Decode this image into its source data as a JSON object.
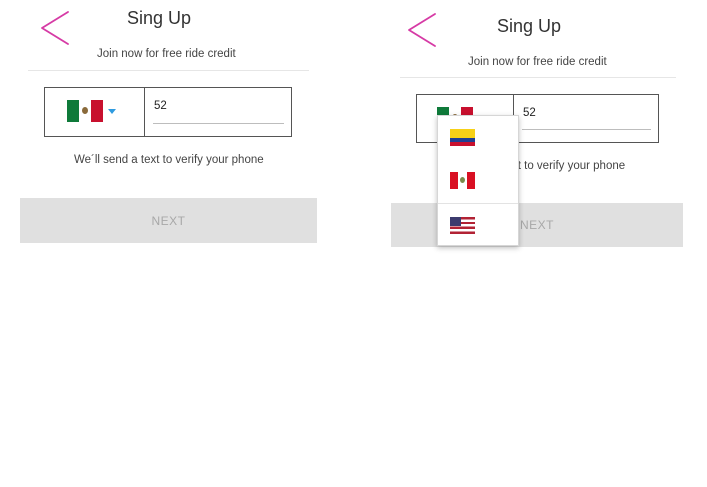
{
  "colors": {
    "back_icon": "#d63aa5",
    "accent_caret": "#2f9be0",
    "button_bg": "#e0e0e0",
    "button_text": "#a8a8a8"
  },
  "screens": [
    {
      "title": "Sing Up",
      "subtitle": "Join now for free ride credit",
      "back_icon": "chevron-left-icon",
      "country_flag": "mexico-flag-icon",
      "dropdown_caret": "caret-down-icon",
      "phone_value": "52",
      "hint": "We´ll send a text to verify your phone",
      "next_label": "NEXT"
    },
    {
      "title": "Sing Up",
      "subtitle": "Join now for free ride credit",
      "back_icon": "chevron-left-icon",
      "country_flag": "mexico-flag-icon",
      "dropdown_caret": "caret-down-icon",
      "phone_value": "52",
      "hint": "xt to verify your phone",
      "next_label": "NEXT",
      "dropdown_options": [
        {
          "icon": "colombia-flag-icon"
        },
        {
          "icon": "peru-flag-icon"
        },
        {
          "icon": "united-states-flag-icon"
        }
      ]
    }
  ]
}
